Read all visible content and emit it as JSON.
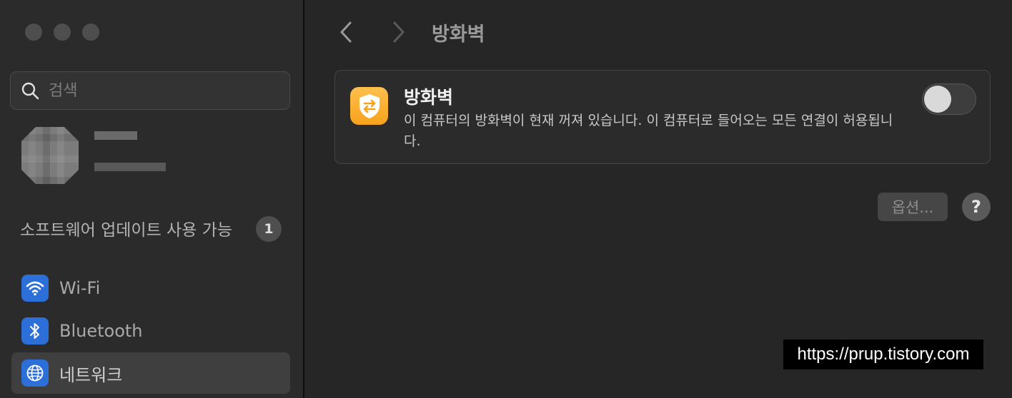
{
  "sidebar": {
    "search": {
      "placeholder": "검색",
      "icon": "search-icon"
    },
    "update": {
      "label": "소프트웨어 업데이트 사용 가능",
      "count": "1"
    },
    "items": [
      {
        "label": "Wi-Fi",
        "icon": "wifi-icon",
        "color": "#2c6fd9"
      },
      {
        "label": "Bluetooth",
        "icon": "bluetooth-icon",
        "color": "#2c6fd9"
      },
      {
        "label": "네트워크",
        "icon": "globe-icon",
        "color": "#2c6fd9",
        "selected": true
      }
    ]
  },
  "header": {
    "title": "방화벽"
  },
  "firewall": {
    "title": "방화벽",
    "description": "이 컴퓨터의 방화벽이 현재 꺼져 있습니다. 이 컴퓨터로 들어오는 모든 연결이 허용됩니다.",
    "enabled": false,
    "icon": "firewall-shield-icon",
    "icon_color": "#f7a21b"
  },
  "actions": {
    "options_label": "옵션...",
    "help_label": "?"
  },
  "watermark": "https://prup.tistory.com"
}
